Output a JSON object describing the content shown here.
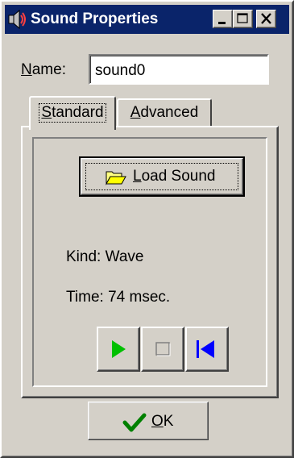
{
  "window": {
    "title": "Sound Properties",
    "title_icon": "speaker-icon",
    "controls": [
      "minimize-icon",
      "maximize-icon",
      "close-icon"
    ]
  },
  "name_field": {
    "label_underlined": "N",
    "label_rest": "ame:",
    "value": "sound0"
  },
  "tabs": [
    {
      "underlined": "S",
      "rest": "tandard",
      "selected": true
    },
    {
      "underlined": "A",
      "rest": "dvanced",
      "selected": false
    }
  ],
  "load_button": {
    "underlined": "L",
    "rest": "oad Sound",
    "icon": "folder-open-icon"
  },
  "info": {
    "kind": "Kind: Wave",
    "time": "Time: 74 msec."
  },
  "playback": [
    {
      "icon": "play-icon",
      "color": "#00c000"
    },
    {
      "icon": "stop-icon",
      "enabled": false
    },
    {
      "icon": "rewind-icon",
      "color": "#0000ff"
    }
  ],
  "ok_button": {
    "underlined": "O",
    "rest": "K",
    "icon": "checkmark-icon",
    "icon_color": "#008000"
  },
  "colors": {
    "titlebar": "#0a246a",
    "face": "#d4d0c8"
  }
}
